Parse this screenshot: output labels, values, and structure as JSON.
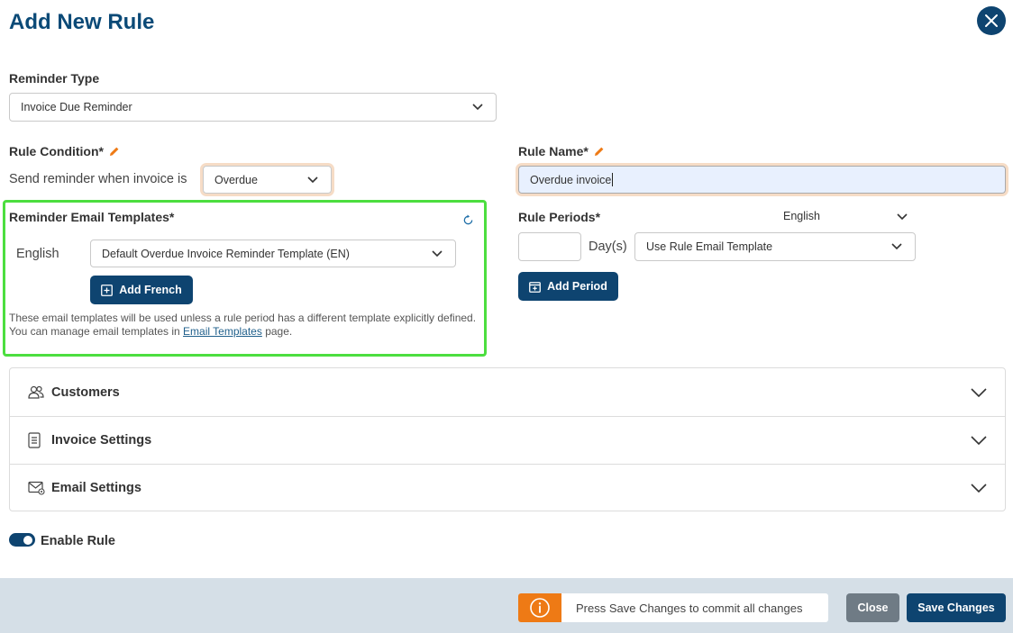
{
  "dialog": {
    "title": "Add New Rule"
  },
  "reminder_type": {
    "label": "Reminder Type",
    "value": "Invoice Due Reminder"
  },
  "rule_condition": {
    "label": "Rule Condition*",
    "sentence": "Send reminder when invoice is",
    "value": "Overdue"
  },
  "rule_name": {
    "label": "Rule Name*",
    "value": "Overdue invoice"
  },
  "templates": {
    "label": "Reminder Email Templates*",
    "language": "English",
    "template_value": "Default Overdue Invoice Reminder Template (EN)",
    "add_button": "Add French",
    "help_before": "These email templates will be used unless a rule period has a different template explicitly defined. You can manage email templates in",
    "help_link": "Email Templates",
    "help_after": "page."
  },
  "rule_periods": {
    "label": "Rule Periods*",
    "language_select": "English",
    "days_value": "",
    "days_label": "Day(s)",
    "template_select": "Use Rule Email Template",
    "add_button": "Add Period"
  },
  "accordion": [
    {
      "label": "Customers",
      "icon": "users-icon"
    },
    {
      "label": "Invoice Settings",
      "icon": "document-icon"
    },
    {
      "label": "Email Settings",
      "icon": "email-settings-icon"
    }
  ],
  "enable_rule": {
    "label": "Enable Rule",
    "enabled": true
  },
  "footer": {
    "notice": "Press Save Changes to commit all changes",
    "close_label": "Close",
    "save_label": "Save Changes"
  },
  "colors": {
    "primary": "#0e4470",
    "title": "#0b4a77",
    "warning": "#ee7a15",
    "highlight": "#4cde3f",
    "footer_bg": "#d5dfe7"
  }
}
